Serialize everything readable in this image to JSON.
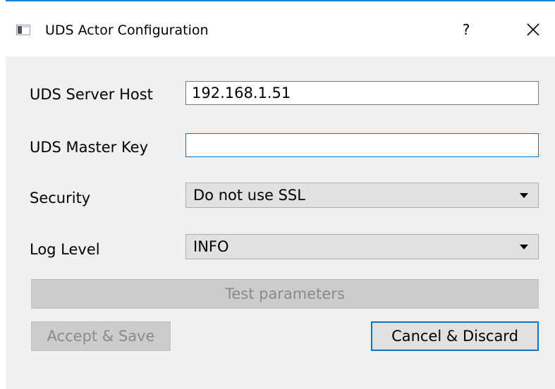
{
  "window": {
    "title": "UDS Actor Configuration",
    "help_label": "?"
  },
  "form": {
    "server_host": {
      "label": "UDS Server Host",
      "value": "192.168.1.51"
    },
    "master_key": {
      "label": "UDS Master Key",
      "value": ""
    },
    "security": {
      "label": "Security",
      "selected": "Do not use SSL"
    },
    "log_level": {
      "label": "Log Level",
      "selected": "INFO"
    }
  },
  "buttons": {
    "test_label": "Test parameters",
    "accept_label": "Accept & Save",
    "cancel_label": "Cancel & Discard"
  },
  "colors": {
    "focus_accent": "#0078d7",
    "dialog_background": "#f0f0f0"
  },
  "icons": {
    "app": "window-app-icon",
    "close": "close-icon",
    "dropdown": "chevron-down-icon"
  }
}
